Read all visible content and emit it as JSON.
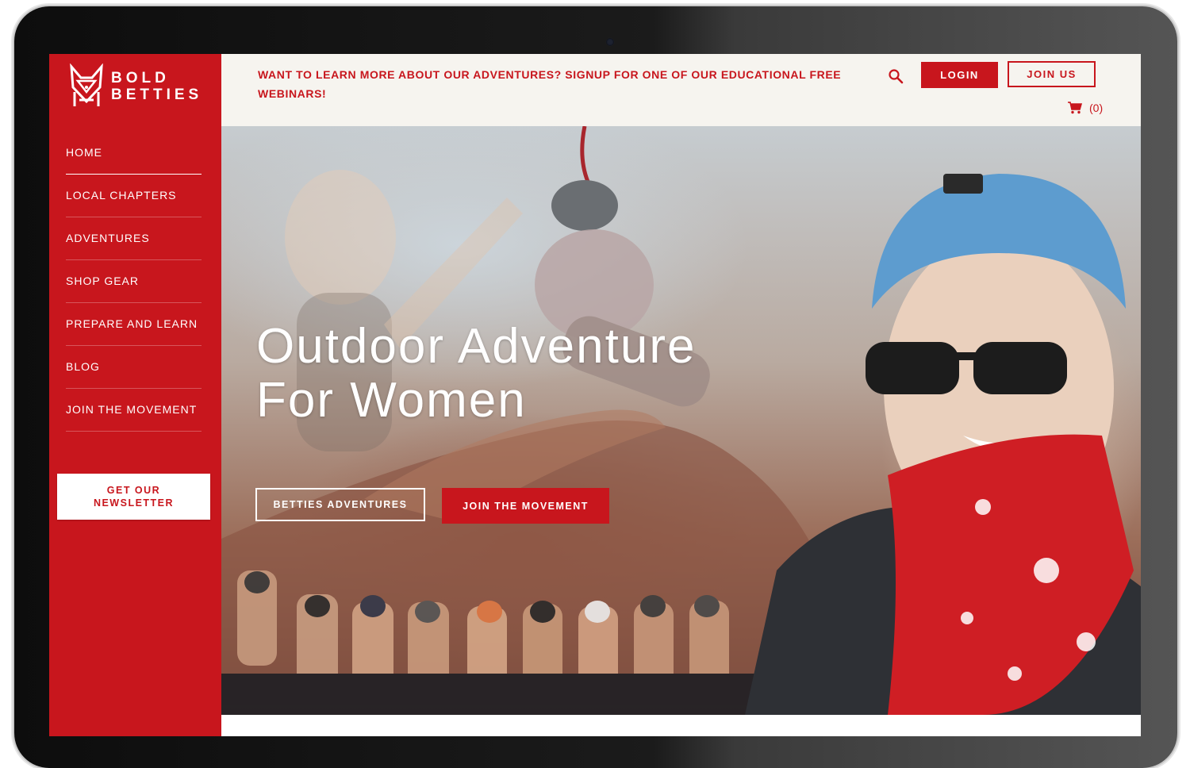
{
  "brand": {
    "logo_text": "BOLD\nBETTIES",
    "accent": "#c8161d"
  },
  "sidebar": {
    "items": [
      {
        "label": "HOME"
      },
      {
        "label": "LOCAL CHAPTERS"
      },
      {
        "label": "ADVENTURES"
      },
      {
        "label": "SHOP GEAR"
      },
      {
        "label": "PREPARE AND LEARN"
      },
      {
        "label": "BLOG"
      },
      {
        "label": "JOIN THE MOVEMENT"
      }
    ],
    "newsletter_label": "GET OUR NEWSLETTER"
  },
  "topbar": {
    "announcement": "WANT TO LEARN MORE ABOUT OUR ADVENTURES? SIGNUP FOR ONE OF OUR EDUCATIONAL FREE WEBINARS!",
    "search_icon": "search-icon",
    "login_label": "LOGIN",
    "join_label": "JOIN US",
    "cart_icon": "shopping-cart-icon",
    "cart_count": "(0)"
  },
  "hero": {
    "title": "Outdoor Adventure For Women",
    "button_outline_label": "BETTIES ADVENTURES",
    "button_solid_label": "JOIN THE MOVEMENT"
  }
}
